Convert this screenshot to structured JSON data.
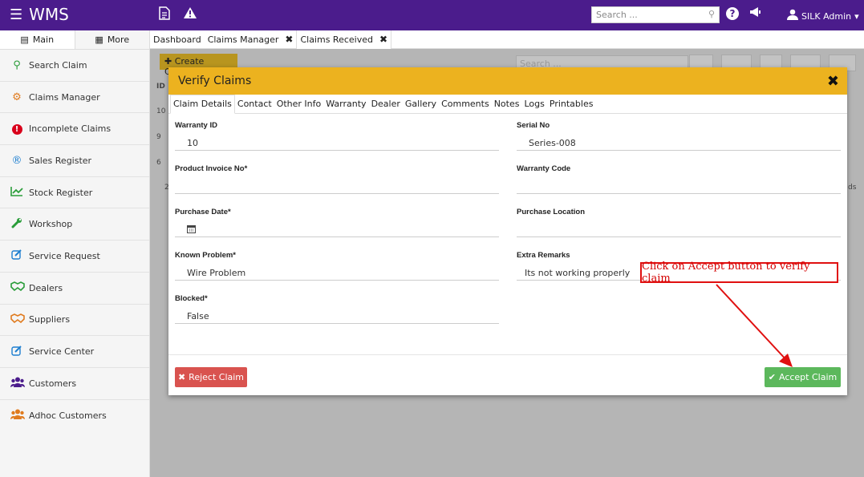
{
  "topbar": {
    "brand": "WMS",
    "search_placeholder": "Search ...",
    "user_label": "SILK Admin",
    "icons": [
      "hamburger-icon",
      "document-icon",
      "warning-icon",
      "help-icon",
      "megaphone-icon",
      "user-icon"
    ]
  },
  "sidebar": {
    "tabs": [
      {
        "label": "Main",
        "icon": "list-icon"
      },
      {
        "label": "More",
        "icon": "grid-icon"
      }
    ],
    "items": [
      {
        "label": "Search Claim",
        "icon": "search-icon",
        "color": "#2a9d3a"
      },
      {
        "label": "Claims Manager",
        "icon": "gears-icon",
        "color": "#e07b1f"
      },
      {
        "label": "Incomplete Claims",
        "icon": "exclamation-icon",
        "color": "#d9001b"
      },
      {
        "label": "Sales Register",
        "icon": "registered-icon",
        "color": "#1e7fd0"
      },
      {
        "label": "Stock Register",
        "icon": "line-chart-icon",
        "color": "#2a9d3a"
      },
      {
        "label": "Workshop",
        "icon": "wrench-icon",
        "color": "#2a9d3a"
      },
      {
        "label": "Service Request",
        "icon": "edit-icon",
        "color": "#1e7fd0"
      },
      {
        "label": "Dealers",
        "icon": "handshake-icon",
        "color": "#2a9d3a"
      },
      {
        "label": "Suppliers",
        "icon": "handshake-icon",
        "color": "#e07b1f"
      },
      {
        "label": "Service Center",
        "icon": "edit-icon",
        "color": "#1e7fd0"
      },
      {
        "label": "Customers",
        "icon": "users-icon",
        "color": "#4b1c8c"
      },
      {
        "label": "Adhoc Customers",
        "icon": "users-icon",
        "color": "#e07b1f"
      }
    ]
  },
  "page_tabs": [
    {
      "label": "Dashboard",
      "closable": false
    },
    {
      "label": "Claims Manager",
      "closable": true
    },
    {
      "label": "Claims Received",
      "closable": true,
      "active": true
    }
  ],
  "background": {
    "create_button": "Create Claims",
    "search_placeholder": "Search ...",
    "id_header": "ID",
    "row_ids": [
      "10",
      "9",
      "6"
    ],
    "page_fragment": "2",
    "records_fragment": "ds"
  },
  "modal": {
    "title": "Verify Claims",
    "tabs": [
      "Claim Details",
      "Contact",
      "Other Info",
      "Warranty",
      "Dealer",
      "Gallery",
      "Comments",
      "Notes",
      "Logs",
      "Printables"
    ],
    "fields_left": [
      {
        "label": "Warranty ID",
        "value": "10"
      },
      {
        "label": "Product Invoice No*",
        "value": ""
      },
      {
        "label": "Purchase Date*",
        "value": ""
      },
      {
        "label": "Known Problem*",
        "value": "Wire Problem"
      },
      {
        "label": "Blocked*",
        "value": "False"
      }
    ],
    "fields_right": [
      {
        "label": "Serial No",
        "value": "Series-008"
      },
      {
        "label": "Warranty Code",
        "value": ""
      },
      {
        "label": "Purchase Location",
        "value": ""
      },
      {
        "label": "Extra Remarks",
        "value": "Its not working properly"
      }
    ],
    "reject_label": "Reject Claim",
    "accept_label": "Accept Claim"
  },
  "annotation": {
    "text": "Click on Accept button to verify claim",
    "color": "#e01010"
  }
}
